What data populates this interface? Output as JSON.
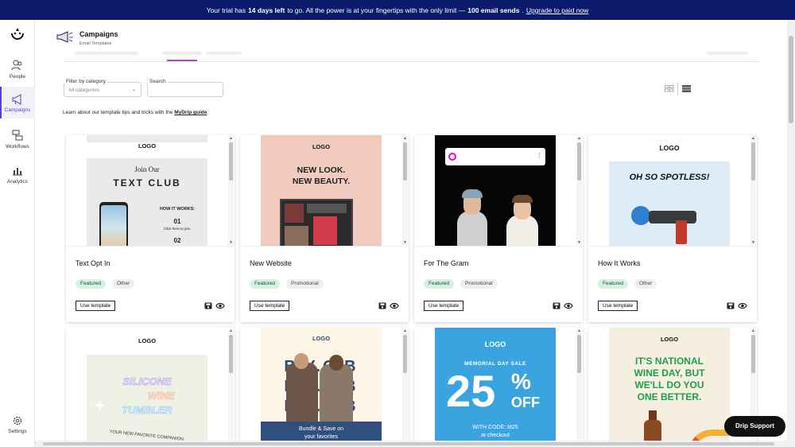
{
  "banner": {
    "prefix": "Your trial has",
    "days": "14 days left",
    "middle": "to go. All the power is at your fingertips with the only limit —",
    "limit": "100 email sends",
    "period": ".",
    "upgrade_link": "Upgrade to paid now"
  },
  "sidebar": {
    "items": [
      {
        "label": "People",
        "icon": "people-icon"
      },
      {
        "label": "Campaigns",
        "icon": "megaphone-icon",
        "active": true
      },
      {
        "label": "Workflows",
        "icon": "workflow-icon"
      },
      {
        "label": "Analytics",
        "icon": "analytics-icon"
      }
    ],
    "settings_label": "Settings"
  },
  "header": {
    "title": "Campaigns",
    "subtitle": "Email Templates"
  },
  "filters": {
    "category_label": "Filter by category",
    "category_value": "All categories",
    "search_label": "Search",
    "search_placeholder": ""
  },
  "info": {
    "text": "Learn about our template tips and tricks with the",
    "link": "MyDrip guide",
    "suffix": "."
  },
  "templates": [
    {
      "title": "Text Opt In",
      "tags": [
        "Featured",
        "Other"
      ],
      "use_label": "Use template",
      "preview": {
        "logo": "LOGO",
        "line1": "Join Our",
        "line2": "TEXT CLUB",
        "how": "HOW IT WORKS:",
        "step1": "01",
        "step1_text": "Click here to join.",
        "step2": "02"
      }
    },
    {
      "title": "New Website",
      "tags": [
        "Featured",
        "Promotional"
      ],
      "use_label": "Use template",
      "preview": {
        "logo": "LOGO",
        "line1": "NEW LOOK.",
        "line2": "NEW BEAUTY."
      }
    },
    {
      "title": "For The Gram",
      "tags": [
        "Featured",
        "Promotional"
      ],
      "use_label": "Use template",
      "preview": {}
    },
    {
      "title": "How It Works",
      "tags": [
        "Featured",
        "Other"
      ],
      "use_label": "Use template",
      "preview": {
        "logo": "LOGO",
        "headline": "OH SO SPOTLESS!"
      }
    },
    {
      "preview": {
        "logo": "LOGO",
        "line1": "SILICONE",
        "line2": "WINE",
        "line3": "TUMBLER",
        "tagline": "YOUR NEW FAVORITE COMPANION."
      }
    },
    {
      "preview": {
        "logo": "LOGO",
        "letters": "B.Y.O.B",
        "caption": "Bundle & Save on",
        "caption2": "your favorites"
      }
    },
    {
      "preview": {
        "logo": "LOGO",
        "line1": "MEMORIAL DAY SALE",
        "big": "25",
        "pct": "%",
        "off": "OFF",
        "code": "WITH CODE: M25",
        "code2": "at checkout"
      }
    },
    {
      "preview": {
        "logo": "LOGO",
        "line1": "IT'S NATIONAL",
        "line2": "WINE DAY, BUT",
        "line3": "WE'LL DO YOU",
        "line4": "ONE BETTER."
      }
    }
  ],
  "support_label": "Drip Support",
  "colors": {
    "banner": "#0c1a6b",
    "accent": "#5a3fd6",
    "featured_tag": "#d5f2e4",
    "tab_underline": "#c43bd1"
  }
}
